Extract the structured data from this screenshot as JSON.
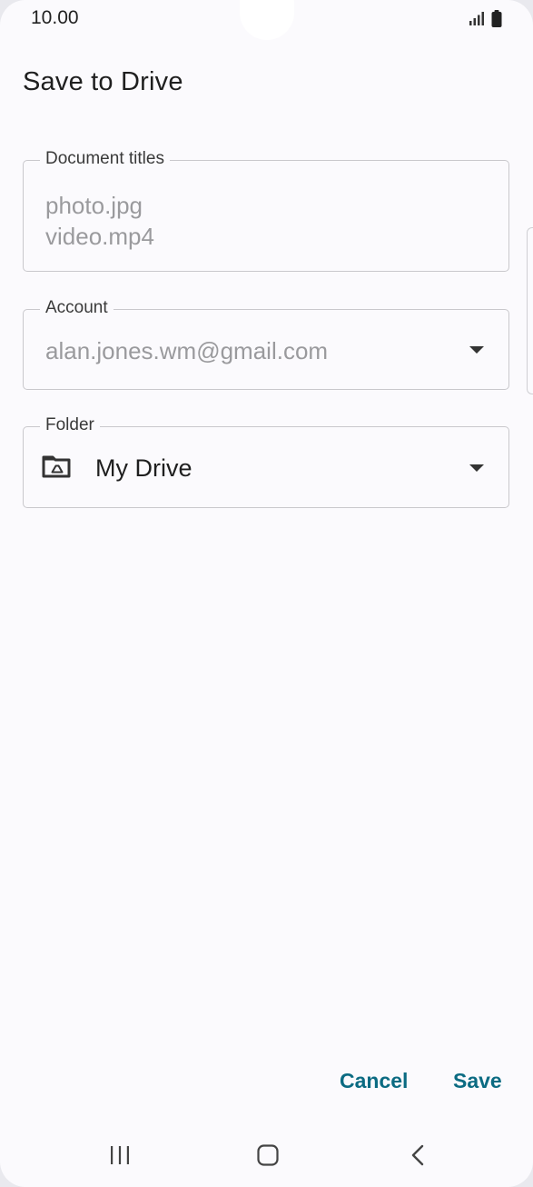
{
  "status_bar": {
    "time": "10.00",
    "icons": [
      "signal-icon",
      "battery-icon"
    ]
  },
  "dialog": {
    "title": "Save to Drive",
    "document_titles": {
      "label": "Document titles",
      "values": [
        "photo.jpg",
        "video.mp4"
      ]
    },
    "account": {
      "label": "Account",
      "value": "alan.jones.wm@gmail.com"
    },
    "folder": {
      "label": "Folder",
      "value": "My Drive",
      "icon": "drive-folder-icon"
    },
    "actions": {
      "cancel_label": "Cancel",
      "save_label": "Save"
    }
  },
  "nav_bar": {
    "icons": [
      "recent-apps-icon",
      "home-icon",
      "back-icon"
    ]
  },
  "colors": {
    "accent": "#0b6b82",
    "background": "#fbfafd",
    "hint_text": "#9a9a9d"
  }
}
